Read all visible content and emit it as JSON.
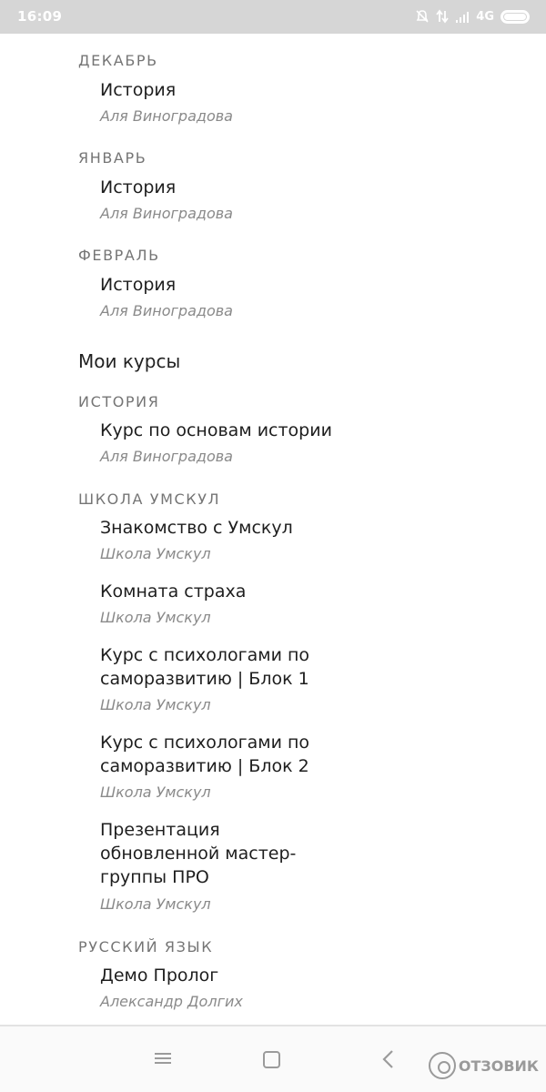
{
  "status_bar": {
    "time": "16:09",
    "network": "4G",
    "icons": [
      "bell-off-icon",
      "data-transfer-icon",
      "signal-icon",
      "battery-icon"
    ]
  },
  "schedule": [
    {
      "month": "ДЕКАБРЬ",
      "title": "История",
      "author": "Аля Виноградова"
    },
    {
      "month": "ЯНВАРЬ",
      "title": "История",
      "author": "Аля Виноградова"
    },
    {
      "month": "ФЕВРАЛЬ",
      "title": "История",
      "author": "Аля Виноградова"
    }
  ],
  "my_courses": {
    "title": "Мои курсы",
    "groups": [
      {
        "name": "ИСТОРИЯ",
        "items": [
          {
            "title": "Курс по основам истории",
            "author": "Аля Виноградова"
          }
        ]
      },
      {
        "name": "ШКОЛА УМСКУЛ",
        "items": [
          {
            "title": "Знакомство с Умскул",
            "author": "Школа Умскул"
          },
          {
            "title": "Комната страха",
            "author": "Школа Умскул"
          },
          {
            "title": "Курс с психологами по саморазвитию | Блок 1",
            "author": "Школа Умскул"
          },
          {
            "title": "Курс с психологами по саморазвитию | Блок 2",
            "author": "Школа Умскул"
          },
          {
            "title": "Презентация обновленной мастер-группы ПРО",
            "author": "Школа Умскул"
          }
        ]
      },
      {
        "name": "РУССКИЙ ЯЗЫК",
        "items": [
          {
            "title": "Демо Пролог",
            "author": "Александр Долгих"
          }
        ]
      }
    ]
  },
  "watermark": "ОТЗОВИК"
}
